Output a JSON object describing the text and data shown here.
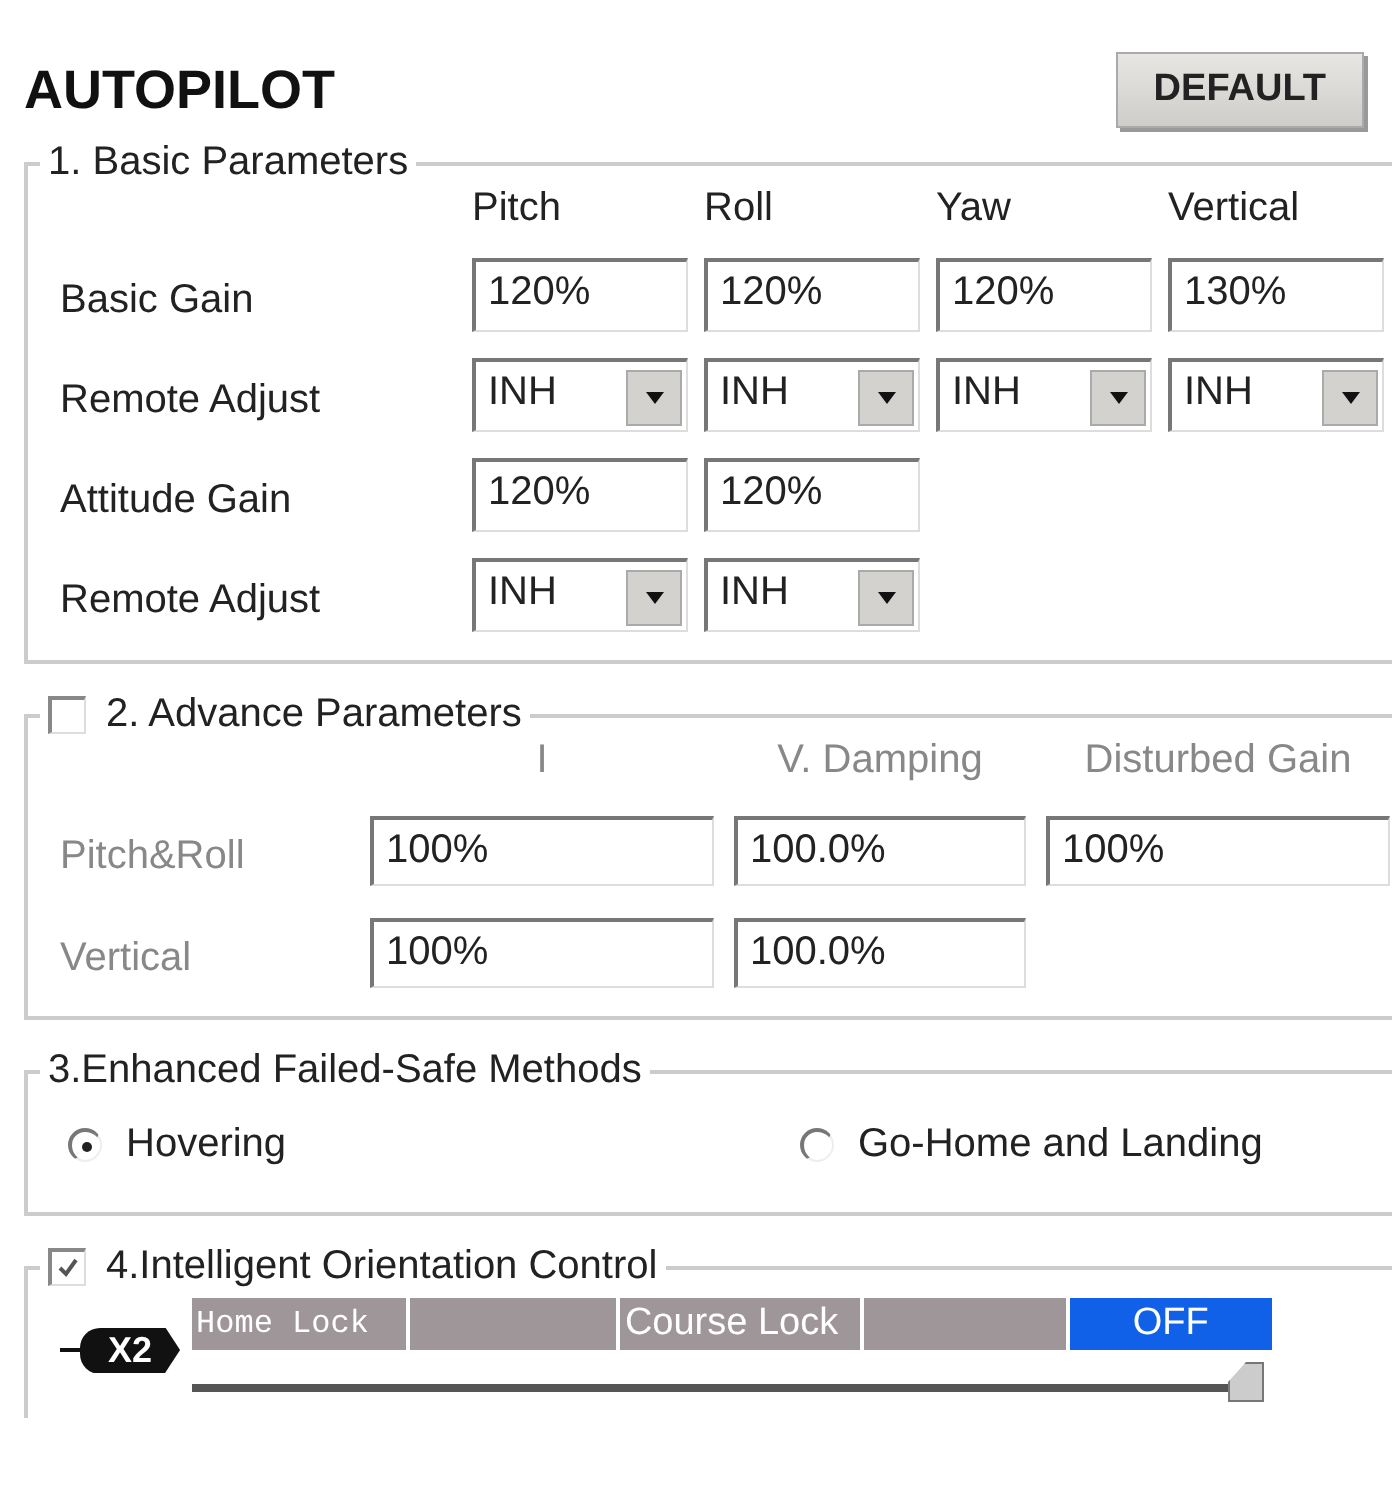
{
  "title": "AUTOPILOT",
  "default_button": "DEFAULT",
  "basic": {
    "title": "1. Basic Parameters",
    "columns": [
      "Pitch",
      "Roll",
      "Yaw",
      "Vertical"
    ],
    "rows": [
      {
        "label": "Basic Gain",
        "cells": [
          {
            "kind": "field",
            "value": "120%"
          },
          {
            "kind": "field",
            "value": "120%"
          },
          {
            "kind": "field",
            "value": "120%"
          },
          {
            "kind": "field",
            "value": "130%"
          }
        ]
      },
      {
        "label": "Remote Adjust",
        "cells": [
          {
            "kind": "dropdown",
            "value": "INH"
          },
          {
            "kind": "dropdown",
            "value": "INH"
          },
          {
            "kind": "dropdown",
            "value": "INH"
          },
          {
            "kind": "dropdown",
            "value": "INH"
          }
        ]
      },
      {
        "label": "Attitude Gain",
        "cells": [
          {
            "kind": "field",
            "value": "120%"
          },
          {
            "kind": "field",
            "value": "120%"
          }
        ]
      },
      {
        "label": "Remote Adjust",
        "cells": [
          {
            "kind": "dropdown",
            "value": "INH"
          },
          {
            "kind": "dropdown",
            "value": "INH"
          }
        ]
      }
    ]
  },
  "advance": {
    "title": "2. Advance Parameters",
    "checked": false,
    "columns": [
      "I",
      "V. Damping",
      "Disturbed Gain"
    ],
    "rows": [
      {
        "label": "Pitch&Roll",
        "cells": [
          "100%",
          "100.0%",
          "100%"
        ]
      },
      {
        "label": "Vertical",
        "cells": [
          "100%",
          "100.0%"
        ]
      }
    ]
  },
  "failsafe": {
    "title": "3.Enhanced Failed-Safe Methods",
    "options": [
      {
        "label": "Hovering",
        "selected": true
      },
      {
        "label": "Go-Home and Landing",
        "selected": false
      }
    ]
  },
  "orientation": {
    "title": "4.Intelligent Orientation Control",
    "checked": true,
    "channel": "X2",
    "segments": [
      {
        "label": "Home Lock",
        "selected": false
      },
      {
        "selected": false
      },
      {
        "label": "Course Lock",
        "selected": false
      },
      {
        "selected": false
      },
      {
        "label": "OFF",
        "selected": true
      }
    ],
    "slider": {
      "level": 1
    }
  }
}
